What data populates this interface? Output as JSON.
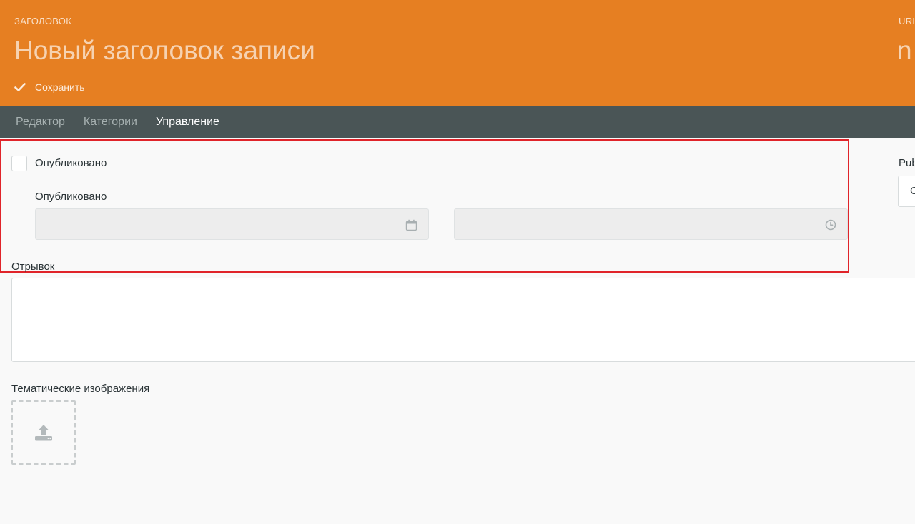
{
  "header": {
    "title_label": "ЗАГОЛОВОК",
    "title_placeholder": "Новый заголовок записи",
    "url_label": "URL",
    "url_value": "n",
    "save_label": "Сохранить"
  },
  "tabs": [
    {
      "label": "Редактор",
      "active": false
    },
    {
      "label": "Категории",
      "active": false
    },
    {
      "label": "Управление",
      "active": true
    }
  ],
  "manage": {
    "published_checkbox_label": "Опубликовано",
    "published_date_label": "Опубликовано",
    "date_value": "",
    "time_value": "",
    "excerpt_label": "Отрывок",
    "excerpt_value": "",
    "featured_images_label": "Тематические изображения"
  },
  "sidebar_right": {
    "label": "Pub",
    "select_value": "C"
  },
  "colors": {
    "header_bg": "#e67f22",
    "tabbar_bg": "#4a5556",
    "highlight_border": "#e0242a"
  }
}
